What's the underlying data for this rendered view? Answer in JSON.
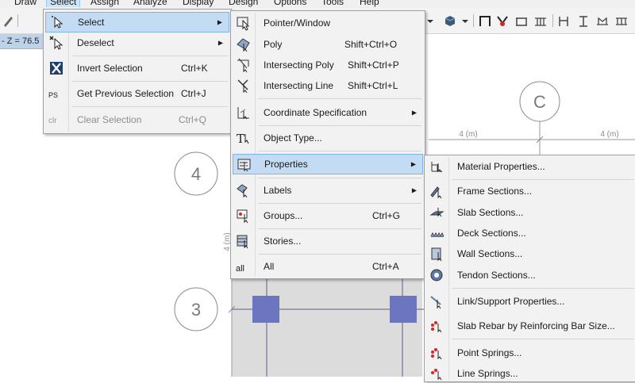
{
  "menubar": [
    "Draw",
    "Select",
    "Assign",
    "Analyze",
    "Display",
    "Design",
    "Options",
    "Tools",
    "Help"
  ],
  "coord_strip": "- Z = 76.5",
  "grid": {
    "labels": [
      "C",
      "4",
      "3"
    ],
    "dims": [
      "4 (m)",
      "4 (m)",
      "4 (m)"
    ]
  },
  "select_menu": [
    {
      "label": "Select",
      "shortcut": "",
      "submenu": true,
      "highlight": true,
      "icon": "select-cursor-icon"
    },
    {
      "label": "Deselect",
      "shortcut": "",
      "submenu": true,
      "icon": "deselect-cursor-icon"
    },
    {
      "label": "Invert Selection",
      "shortcut": "Ctrl+K",
      "icon": "invert-selection-icon"
    },
    {
      "label": "Get Previous Selection",
      "shortcut": "Ctrl+J",
      "icon": "previous-selection-icon",
      "icon_text": "PS"
    },
    {
      "label": "Clear Selection",
      "shortcut": "Ctrl+Q",
      "disabled": true,
      "icon": "clear-selection-icon",
      "icon_text": "clr"
    }
  ],
  "select_submenu": [
    {
      "label": "Pointer/Window",
      "shortcut": "",
      "icon": "pointer-window-icon"
    },
    {
      "label": "Poly",
      "shortcut": "Shift+Ctrl+O",
      "icon": "poly-icon"
    },
    {
      "label": "Intersecting Poly",
      "shortcut": "Shift+Ctrl+P",
      "icon": "intersecting-poly-icon"
    },
    {
      "label": "Intersecting Line",
      "shortcut": "Shift+Ctrl+L",
      "icon": "intersecting-line-icon"
    },
    {
      "label": "Coordinate Specification",
      "shortcut": "",
      "submenu": true,
      "icon": "coordinate-specification-icon"
    },
    {
      "label": "Object Type...",
      "shortcut": "",
      "icon": "object-type-icon"
    },
    {
      "label": "Properties",
      "shortcut": "",
      "submenu": true,
      "highlight": true,
      "icon": "properties-icon"
    },
    {
      "label": "Labels",
      "shortcut": "",
      "submenu": true,
      "icon": "labels-icon"
    },
    {
      "label": "Groups...",
      "shortcut": "Ctrl+G",
      "icon": "groups-icon"
    },
    {
      "label": "Stories...",
      "shortcut": "",
      "icon": "stories-icon"
    },
    {
      "label": "All",
      "shortcut": "Ctrl+A",
      "icon": "select-all-icon",
      "icon_text": "all"
    }
  ],
  "properties_submenu": [
    {
      "label": "Material Properties...",
      "icon": "material-properties-icon"
    },
    {
      "label": "Frame Sections...",
      "icon": "frame-sections-icon"
    },
    {
      "label": "Slab Sections...",
      "icon": "slab-sections-icon"
    },
    {
      "label": "Deck Sections...",
      "icon": "deck-sections-icon"
    },
    {
      "label": "Wall Sections...",
      "icon": "wall-sections-icon"
    },
    {
      "label": "Tendon Sections...",
      "icon": "tendon-sections-icon"
    },
    {
      "label": "Link/Support Properties...",
      "icon": "link-support-icon"
    },
    {
      "label": "Slab Rebar by Reinforcing Bar Size...",
      "icon": "slab-rebar-icon"
    },
    {
      "label": "Point Springs...",
      "icon": "point-springs-icon"
    },
    {
      "label": "Line Springs...",
      "icon": "line-springs-icon"
    }
  ],
  "colors": {
    "highlight_bg": "#c3dcf3",
    "highlight_border": "#7eb4ea",
    "column_fill": "#6b75c0",
    "slab_fill": "#dcdcdc"
  }
}
